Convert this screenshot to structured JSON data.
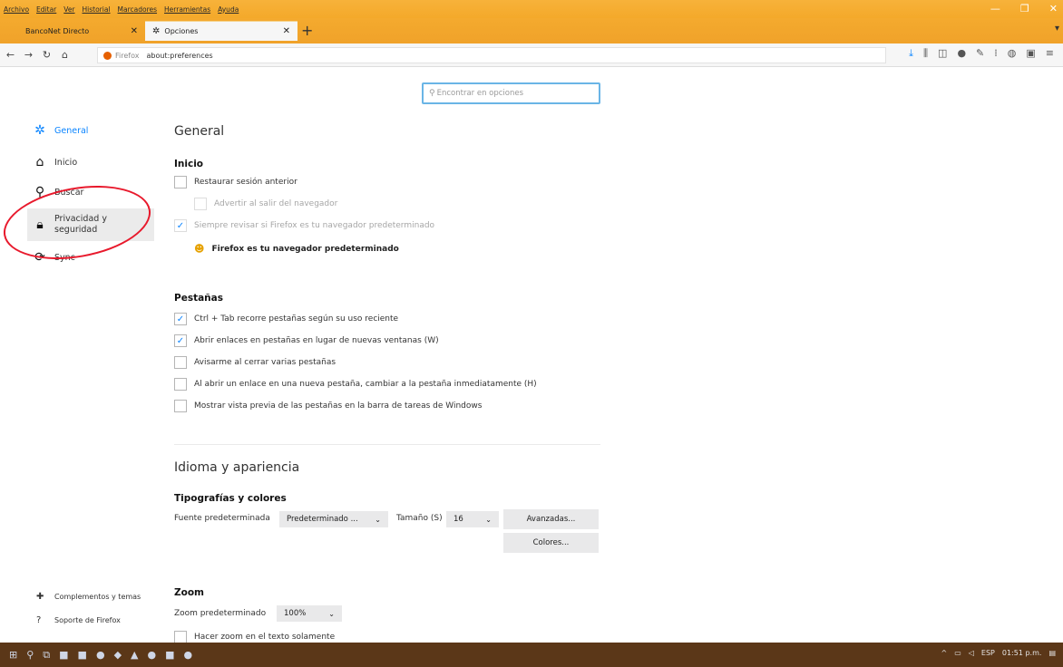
{
  "menubar": {
    "items": [
      "Archivo",
      "Editar",
      "Ver",
      "Historial",
      "Marcadores",
      "Herramientas",
      "Ayuda"
    ]
  },
  "tabs": [
    {
      "label": "BancoNet Directo",
      "active": false
    },
    {
      "label": "Opciones",
      "active": true
    }
  ],
  "navbar": {
    "identity": "Firefox",
    "url": "about:preferences"
  },
  "search": {
    "placeholder": "Encontrar en opciones"
  },
  "sidebar": {
    "items": [
      {
        "label": "General",
        "icon": "gear-icon"
      },
      {
        "label": "Inicio",
        "icon": "home-icon"
      },
      {
        "label": "Buscar",
        "icon": "search-icon"
      },
      {
        "label": "Privacidad y seguridad",
        "icon": "lock-icon"
      },
      {
        "label": "Sync",
        "icon": "sync-icon"
      }
    ],
    "footer": [
      {
        "label": "Complementos y temas",
        "icon": "puzzle-icon"
      },
      {
        "label": "Soporte de Firefox",
        "icon": "help-icon"
      }
    ]
  },
  "general": {
    "title": "General",
    "startup": {
      "heading": "Inicio",
      "restore": "Restaurar sesión anterior",
      "warn_quit": "Advertir al salir del navegador",
      "check_default": "Siempre revisar si Firefox es tu navegador predeterminado",
      "is_default": "Firefox es tu navegador predeterminado"
    },
    "tabs": {
      "heading": "Pestañas",
      "ctrl_tab": "Ctrl + Tab recorre pestañas según su uso reciente",
      "open_links": "Abrir enlaces en pestañas en lugar de nuevas ventanas (W)",
      "warn_close": "Avisarme al cerrar varias pestañas",
      "switch_tab": "Al abrir un enlace en una nueva pestaña, cambiar a la pestaña inmediatamente (H)",
      "previews": "Mostrar vista previa de las pestañas en la barra de tareas de Windows"
    }
  },
  "language": {
    "title": "Idioma y apariencia",
    "fonts_heading": "Tipografías y colores",
    "default_font_label": "Fuente predeterminada",
    "default_font_value": "Predeterminado ...",
    "size_label": "Tamaño (S)",
    "size_value": "16",
    "advanced_btn": "Avanzadas...",
    "colors_btn": "Colores..."
  },
  "zoom": {
    "heading": "Zoom",
    "default_label": "Zoom predeterminado",
    "default_value": "100%",
    "text_only": "Hacer zoom en el texto solamente"
  },
  "taskbar": {
    "lang": "ESP",
    "time": "01:51 p.m."
  },
  "colors": {
    "accent": "#0a84ff",
    "annotation": "#e8192c",
    "titlebar": "#f4a92a",
    "taskbar": "#5b3718"
  }
}
